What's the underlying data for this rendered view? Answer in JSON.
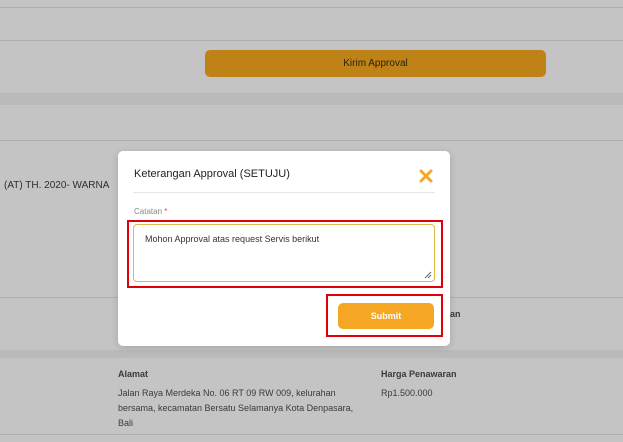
{
  "background": {
    "kirim_button_label": "Kirim Approval",
    "vehicle_text": "(AT) TH. 2020- WARNA",
    "partial_label": "an",
    "address_label": "Alamat",
    "address_value": "Jalan Raya Merdeka No. 06 RT 09 RW 009, kelurahan bersama, kecamatan Bersatu Selamanya Kota Denpasara, Bali",
    "price_label": "Harga Penawaran",
    "price_value": "Rp1.500.000"
  },
  "modal": {
    "title": "Keterangan Approval (SETUJU)",
    "close_icon": "close-x-icon",
    "field_label": "Catatan",
    "required_mark": "*",
    "notes_value": "Mohon Approval atas request Servis berikut",
    "submit_label": "Submit"
  },
  "colors": {
    "accent": "#f5a623",
    "highlight": "#e0000a",
    "overlay": "#c4c4c4"
  }
}
